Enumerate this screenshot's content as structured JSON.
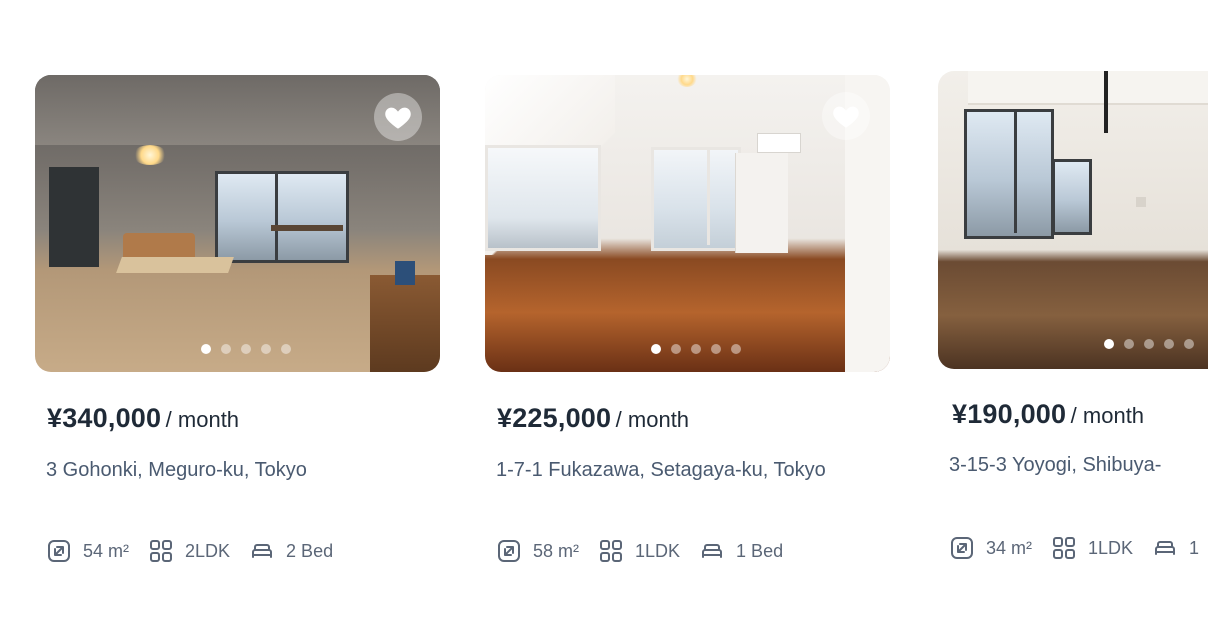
{
  "listings": [
    {
      "price": "¥340,000",
      "per": "/ month",
      "address": "3 Gohonki, Meguro-ku, Tokyo",
      "area": "54 m²",
      "layout": "2LDK",
      "beds": "2 Bed",
      "favorite_icon": "heart-icon",
      "photo_count": 5,
      "active_photo": 1
    },
    {
      "price": "¥225,000",
      "per": "/ month",
      "address": "1-7-1 Fukazawa, Setagaya-ku, Tokyo",
      "area": "58 m²",
      "layout": "1LDK",
      "beds": "1 Bed",
      "favorite_icon": "heart-icon",
      "photo_count": 5,
      "active_photo": 1
    },
    {
      "price": "¥190,000",
      "per": "/ month",
      "address": "3-15-3 Yoyogi, Shibuya-",
      "area": "34 m²",
      "layout": "1LDK",
      "beds": "1",
      "photo_count": 5,
      "active_photo": 1
    }
  ],
  "icons": {
    "area": "area-expand-icon",
    "layout": "floor-plan-icon",
    "beds": "bed-icon"
  },
  "colors": {
    "price_text": "#1f2a37",
    "address_text": "#4a5a70",
    "spec_text": "#5b6677"
  }
}
